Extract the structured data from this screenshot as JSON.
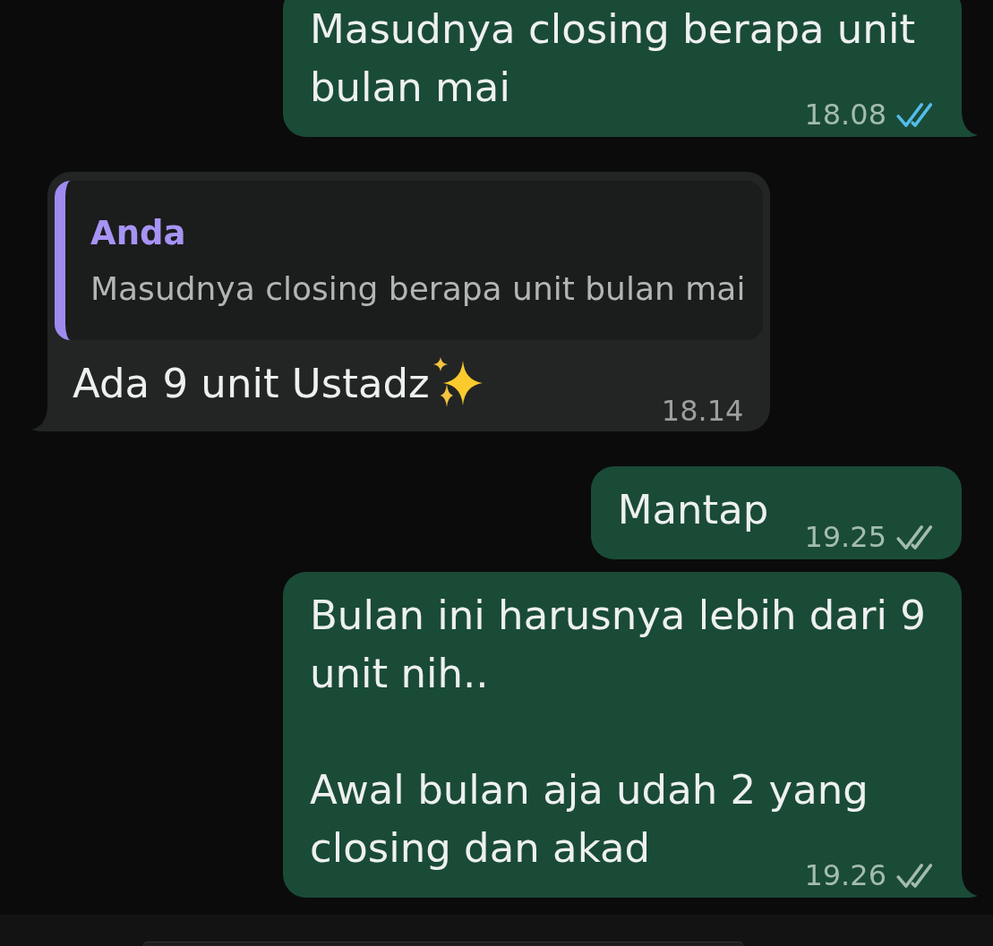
{
  "messages": [
    {
      "kind": "outgoing",
      "text": "Masudnya closing berapa unit bulan mai",
      "trailing_emoji": false,
      "time": "18.08",
      "read": true,
      "tail": true
    },
    {
      "kind": "incoming",
      "reply_to": {
        "author": "Anda",
        "text": "Masudnya closing berapa unit bulan mai"
      },
      "text": "Ada 9 unit Ustadz",
      "trailing_emoji": true,
      "time": "18.14",
      "tail": true
    },
    {
      "kind": "outgoing",
      "text": "Mantap",
      "trailing_emoji": false,
      "time": "19.25",
      "read": false,
      "tail": false
    },
    {
      "kind": "outgoing",
      "text": "Bulan ini harusnya lebih dari 9 unit nih..\n\nAwal bulan aja udah 2 yang closing dan akad",
      "trailing_emoji": false,
      "time": "19.26",
      "read": false,
      "tail": true
    }
  ]
}
